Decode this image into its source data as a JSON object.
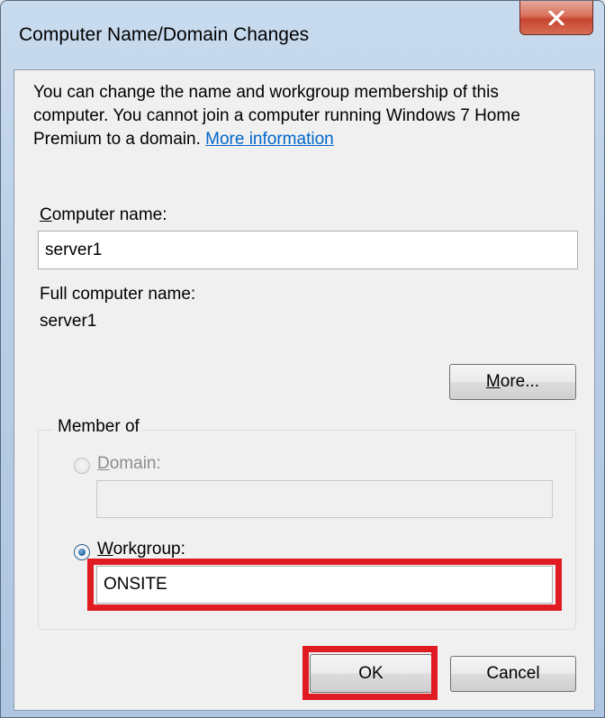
{
  "window": {
    "title": "Computer Name/Domain Changes",
    "close_symbol": "X"
  },
  "intro": {
    "text": "You can change the name and workgroup membership of this computer. You cannot join a computer running Windows 7 Home Premium to a domain. ",
    "link": "More information"
  },
  "computer_name": {
    "label_first": "C",
    "label_rest": "omputer name:",
    "value": "server1"
  },
  "full_name": {
    "label": "Full computer name:",
    "value": "server1"
  },
  "more_button": {
    "label_first": "M",
    "label_rest": "ore..."
  },
  "member_of": {
    "legend": "Member of",
    "domain": {
      "label_first": "D",
      "label_rest": "omain:",
      "selected": false,
      "enabled": false,
      "value": ""
    },
    "workgroup": {
      "label_first": "W",
      "label_rest": "orkgroup:",
      "selected": true,
      "value": "ONSITE"
    }
  },
  "buttons": {
    "ok": "OK",
    "cancel": "Cancel"
  },
  "colors": {
    "highlight": "#e01b22",
    "link": "#0066cc",
    "dialog_bg": "#f0f0f0"
  }
}
